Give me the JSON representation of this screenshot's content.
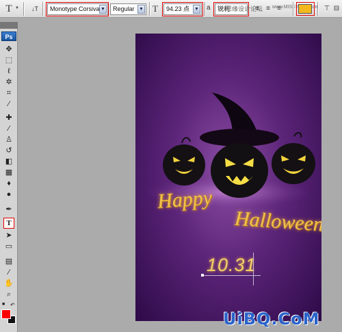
{
  "options_bar": {
    "tool_glyph": "T",
    "orientation_glyph": "↓T",
    "font_family": "Monotype Corsiva",
    "font_style": "Regular",
    "font_size_glyph": "T",
    "font_size": "94.23 点",
    "aa_glyph": "a",
    "aa_method": "锐利",
    "align_glyphs": [
      "≡",
      "≡",
      "≡"
    ],
    "color_swatch": "#f3b81e",
    "extra_glyph": "⊟"
  },
  "watermark_top": "思缘设计论坛",
  "watermark_top2": "www.MISSYUAN.com",
  "watermark_bottom": "UiBQ.CoM",
  "tools": {
    "logo": "Ps",
    "selected": "T"
  },
  "canvas": {
    "happy_text": "Happy",
    "halloween_text": "Halloween",
    "date_text": "10.31"
  },
  "colors": {
    "foreground": "#ff0000",
    "background": "#000000",
    "canvas_bg": "#5b2478",
    "text_gold": "#f0c24a"
  }
}
